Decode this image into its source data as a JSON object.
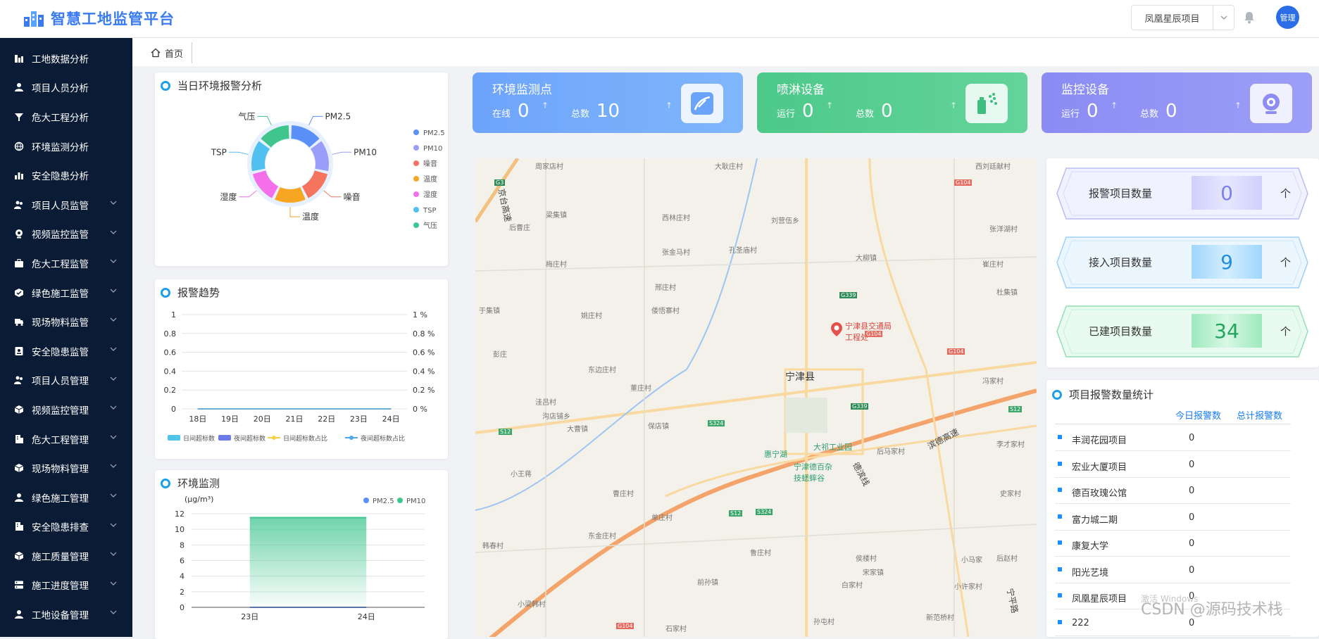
{
  "app": {
    "title": "智慧工地监管平台",
    "project_select": "凤凰星辰项目",
    "user": "管理"
  },
  "sidebar": {
    "items": [
      {
        "label": "工地数据分析",
        "icon": "chart-icon",
        "expandable": false
      },
      {
        "label": "项目人员分析",
        "icon": "person-icon",
        "expandable": false
      },
      {
        "label": "危大工程分析",
        "icon": "funnel-icon",
        "expandable": false
      },
      {
        "label": "环境监测分析",
        "icon": "globe-icon",
        "expandable": false
      },
      {
        "label": "安全隐患分析",
        "icon": "bar-chart-icon",
        "expandable": false
      },
      {
        "label": "项目人员监管",
        "icon": "people-icon",
        "expandable": true
      },
      {
        "label": "视频监控监管",
        "icon": "camera-icon",
        "expandable": true
      },
      {
        "label": "危大工程监管",
        "icon": "toolbox-icon",
        "expandable": true
      },
      {
        "label": "绿色施工监管",
        "icon": "leaf-icon",
        "expandable": true
      },
      {
        "label": "现场物料监管",
        "icon": "truck-icon",
        "expandable": true
      },
      {
        "label": "安全隐患监管",
        "icon": "shield-icon",
        "expandable": true
      },
      {
        "label": "项目人员管理",
        "icon": "people-icon",
        "expandable": true
      },
      {
        "label": "视频监控管理",
        "icon": "cube-icon",
        "expandable": true
      },
      {
        "label": "危大工程管理",
        "icon": "building-icon",
        "expandable": true
      },
      {
        "label": "现场物料管理",
        "icon": "cube-icon",
        "expandable": true
      },
      {
        "label": "绿色施工管理",
        "icon": "person-icon",
        "expandable": true
      },
      {
        "label": "安全隐患排查",
        "icon": "building-icon",
        "expandable": true
      },
      {
        "label": "施工质量管理",
        "icon": "cube-icon",
        "expandable": true
      },
      {
        "label": "施工进度管理",
        "icon": "server-icon",
        "expandable": true
      },
      {
        "label": "工地设备管理",
        "icon": "person-icon",
        "expandable": true
      }
    ]
  },
  "tabs": {
    "home": "首页"
  },
  "env_alarm": {
    "title": "当日环境报警分析",
    "segments": [
      {
        "label": "PM2.5",
        "color": "#5b8ff9"
      },
      {
        "label": "PM10",
        "color": "#9b9dfa"
      },
      {
        "label": "噪音",
        "color": "#f4745e"
      },
      {
        "label": "温度",
        "color": "#f6a623"
      },
      {
        "label": "湿度",
        "color": "#f46fe9"
      },
      {
        "label": "TSP",
        "color": "#4fc0ef"
      },
      {
        "label": "气压",
        "color": "#40c58f"
      }
    ]
  },
  "stat_cards": [
    {
      "title": "环境监测点",
      "label1": "在线",
      "value1": "0",
      "label2": "总数",
      "value2": "10"
    },
    {
      "title": "喷淋设备",
      "label1": "运行",
      "value1": "0",
      "label2": "总数",
      "value2": "0"
    },
    {
      "title": "监控设备",
      "label1": "运行",
      "value1": "0",
      "label2": "总数",
      "value2": "0"
    }
  ],
  "trend": {
    "title": "报警趋势",
    "legend": [
      "日间超标数",
      "夜间超标数",
      "日间超标数占比",
      "夜间超标数占比"
    ]
  },
  "env_monitor": {
    "title": "环境监测",
    "unit": "(μg/m³)"
  },
  "kpis": [
    {
      "label": "报警项目数量",
      "value": "0",
      "unit": "个"
    },
    {
      "label": "接入项目数量",
      "value": "9",
      "unit": "个"
    },
    {
      "label": "已建项目数量",
      "value": "34",
      "unit": "个"
    }
  ],
  "alarm_stats": {
    "title": "项目报警数量统计",
    "col_today": "今日报警数",
    "col_total": "总计报警数",
    "rows": [
      {
        "name": "丰润花园项目",
        "count": "0"
      },
      {
        "name": "宏业大厦项目",
        "count": "0"
      },
      {
        "name": "德百玫瑰公馆",
        "count": "0"
      },
      {
        "name": "富力城二期",
        "count": "0"
      },
      {
        "name": "康复大学",
        "count": "0"
      },
      {
        "name": "阳光艺境",
        "count": "0"
      },
      {
        "name": "凤凰星辰项目",
        "count": "0"
      },
      {
        "name": "222",
        "count": "0"
      }
    ]
  },
  "map": {
    "labels": [
      "周家店村",
      "大耿庄村",
      "西刘廷献村",
      "梁集镇",
      "后曹庄",
      "西林庄村",
      "刘营伍乡",
      "张洋湖村",
      "张金马村",
      "孔圣庙村",
      "大柳镇",
      "崔庄村",
      "梅庄村",
      "邢庄村",
      "杜集镇",
      "于集镇",
      "倭悟寨村",
      "姚庄村",
      "宁津县交通局工程处",
      "彭庄",
      "东边庄村",
      "宁津县",
      "冯家村",
      "董庄村",
      "洼吕村",
      "沟店铺乡",
      "大曹镇",
      "保店镇",
      "大祁工业园",
      "惠宁湖",
      "宁津德百杂技蟋蟀谷",
      "后马家村",
      "李才家村",
      "小王蒋",
      "曹庄村",
      "史家村",
      "单庄村",
      "鲁庄村",
      "东金庄村",
      "韩春村",
      "侯楼村",
      "宋家镇",
      "小马家",
      "后赵村",
      "前孙镇",
      "白家村",
      "小许家村",
      "小梁韩村",
      "石家村",
      "孙屯村",
      "新范桥村"
    ],
    "roads": [
      "京台高速",
      "滨德高速",
      "德滨线",
      "宁平路"
    ],
    "road_codes": [
      "G3",
      "G104",
      "G339",
      "G104",
      "G104",
      "G339",
      "S12",
      "S324",
      "S12",
      "S12",
      "S324",
      "G104"
    ]
  },
  "chart_data": [
    {
      "type": "pie",
      "title": "当日环境报警分析",
      "categories": [
        "PM2.5",
        "PM10",
        "噪音",
        "温度",
        "湿度",
        "TSP",
        "气压"
      ],
      "values": [
        1,
        1,
        1,
        1,
        1,
        1,
        1
      ]
    },
    {
      "type": "line",
      "title": "报警趋势",
      "categories": [
        "18日",
        "19日",
        "20日",
        "21日",
        "22日",
        "23日",
        "24日"
      ],
      "yticks_left": [
        "0",
        "0.2",
        "0.4",
        "0.6",
        "0.8",
        "1"
      ],
      "yticks_right": [
        "0 %",
        "0.2 %",
        "0.4 %",
        "0.6 %",
        "0.8 %",
        "1 %"
      ],
      "ylim": [
        0,
        1
      ],
      "series": [
        {
          "name": "日间超标数",
          "values": [
            0,
            0,
            0,
            0,
            0,
            0,
            0
          ]
        },
        {
          "name": "夜间超标数",
          "values": [
            0,
            0,
            0,
            0,
            0,
            0,
            0
          ]
        },
        {
          "name": "日间超标数占比",
          "values": [
            0,
            0,
            0,
            0,
            0,
            0,
            0
          ]
        },
        {
          "name": "夜间超标数占比",
          "values": [
            0,
            0,
            0,
            0,
            0,
            0,
            0
          ]
        }
      ]
    },
    {
      "type": "area",
      "title": "环境监测",
      "ylabel": "(μg/m³)",
      "categories": [
        "23日",
        "24日"
      ],
      "yticks": [
        "0",
        "2",
        "4",
        "6",
        "8",
        "10",
        "12"
      ],
      "ylim": [
        0,
        12
      ],
      "series": [
        {
          "name": "PM2.5",
          "values": [
            0,
            0
          ]
        },
        {
          "name": "PM10",
          "values": [
            11.5,
            11.5
          ]
        }
      ]
    }
  ]
}
